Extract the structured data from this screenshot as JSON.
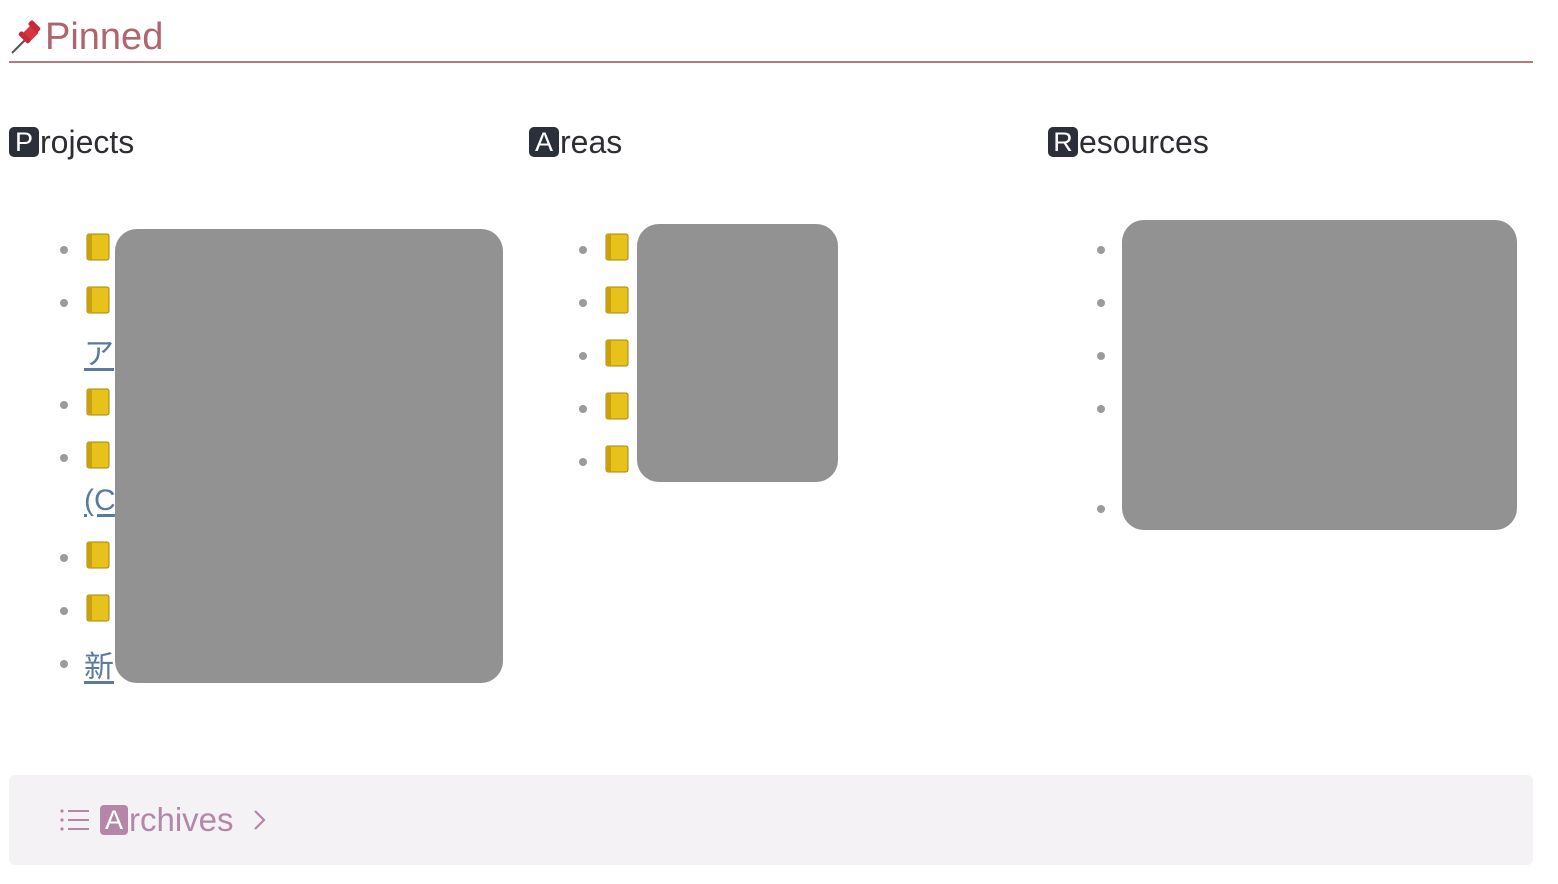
{
  "pinned": {
    "title": "Pinned"
  },
  "columns": [
    {
      "letter": "P",
      "rest": "rojects",
      "items": [
        {
          "text": "",
          "icon": "notebook-icon"
        },
        {
          "text": "",
          "icon": "notebook-icon",
          "second_line": "ア"
        },
        {
          "text": "",
          "icon": "notebook-icon"
        },
        {
          "text": "",
          "icon": "notebook-icon",
          "second_line": "(C"
        },
        {
          "text": "",
          "icon": "notebook-icon"
        },
        {
          "text": "",
          "icon": "notebook-icon"
        },
        {
          "text": "新",
          "icon": ""
        }
      ]
    },
    {
      "letter": "A",
      "rest": "reas",
      "items": [
        {
          "text": "",
          "icon": "notebook-icon"
        },
        {
          "text": "",
          "icon": "notebook-icon"
        },
        {
          "text": "",
          "icon": "notebook-icon"
        },
        {
          "text": "",
          "icon": "notebook-icon"
        },
        {
          "text": "",
          "icon": "notebook-icon"
        }
      ]
    },
    {
      "letter": "R",
      "rest": "esources",
      "items": [
        {
          "text": ""
        },
        {
          "text": ""
        },
        {
          "text": ""
        },
        {
          "text": ""
        },
        {
          "text": ""
        }
      ]
    }
  ],
  "archives": {
    "letter": "A",
    "rest": "rchives"
  },
  "icons": {
    "pin": "pushpin-icon",
    "list": "list-icon",
    "chevron": "chevron-right-icon",
    "notebook": "notebook-icon"
  },
  "colors": {
    "pinned_accent": "#b0646d",
    "link": "#5c7aa0",
    "archives_accent": "#b486a8",
    "redaction": "#929292"
  }
}
